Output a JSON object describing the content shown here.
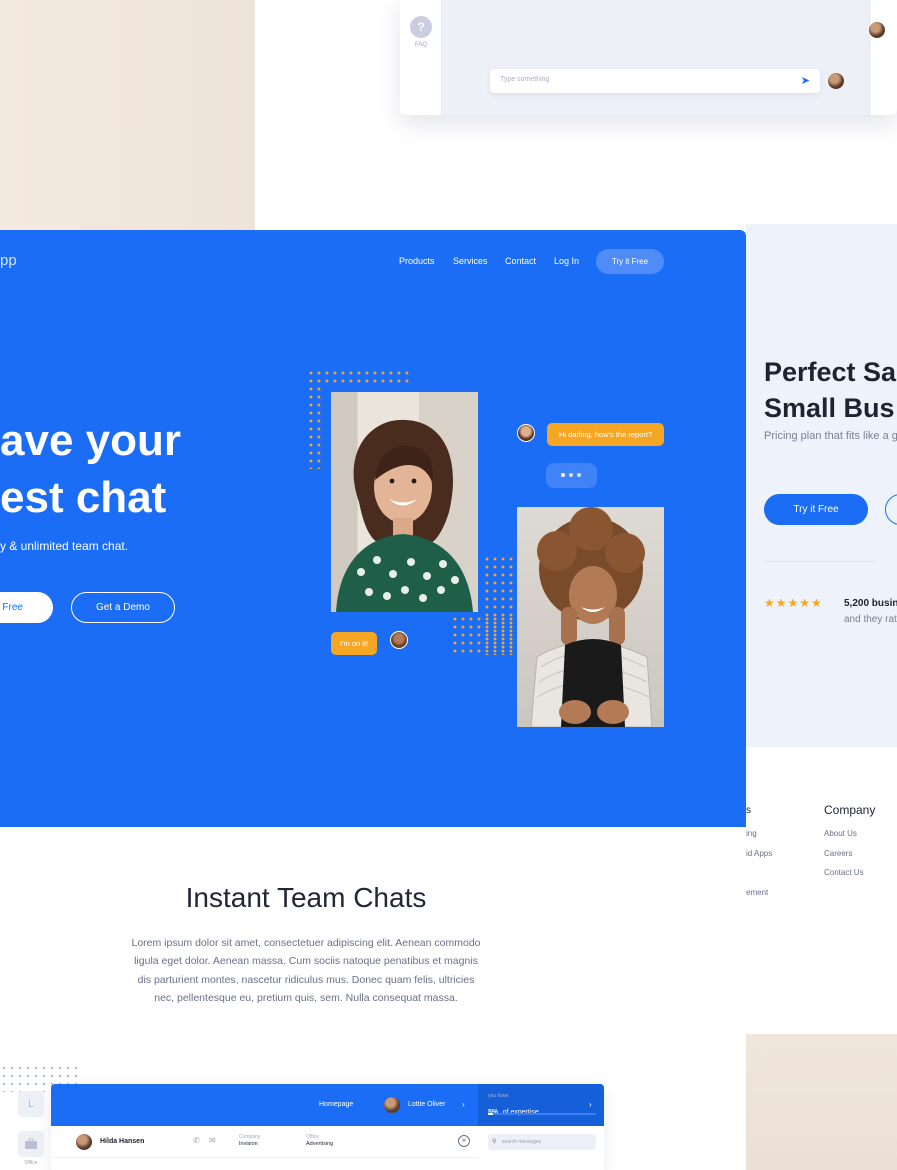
{
  "top_app": {
    "faq_label": "FAQ",
    "faq_icon": "?",
    "message_placeholder": "Type something",
    "send_icon": "➤"
  },
  "hero": {
    "logo_fragment": "pp",
    "nav": [
      "Products",
      "Services",
      "Contact",
      "Log In"
    ],
    "try_free_label": "Try it Free",
    "headline_line1": "ave your",
    "headline_line2": "est chat",
    "subheadline": "y & unlimited team chat.",
    "start_button_label": "t Free",
    "demo_button_label": "Get a Demo",
    "chat_bubble_top": "Hi darling, how's the report?",
    "chat_bubble_bottom": "I'm on it!"
  },
  "pricing": {
    "title_line1": "Perfect Sa",
    "title_line2": "Small Bus",
    "subtitle": "Pricing plan that fits like a g",
    "try_free_label": "Try it Free",
    "stars": "★★★★★",
    "rating": 5,
    "stat_bold": "5,200 busin",
    "stat_sub": "and they rat"
  },
  "footer": {
    "col_a_heading": "s",
    "col_a_items": [
      "ing",
      "id Apps",
      "ement"
    ],
    "company_heading": "Company",
    "company_links": [
      "About Us",
      "Careers",
      "Contact Us"
    ]
  },
  "instant": {
    "title": "Instant Team Chats",
    "paragraph": "Lorem ipsum dolor sit amet, consectetuer adipiscing elit. Aenean commodo ligula eget dolor. Aenean massa. Cum sociis natoque penatibus et magnis dis parturient montes, nascetur ridiculus mus. Donec quam felis, ultricies nec, pellentesque eu, pretium quis, sem. Nulla consequat massa."
  },
  "preview": {
    "side_letter": "L",
    "side_label": "Office",
    "homepage_label": "Homepage",
    "user_name": "Lottie Oliver",
    "expertise_caption": "you have",
    "expertise_value": "5%",
    "expertise_text": "of expertise",
    "expertise_fraction": 0.05,
    "contact_name": "Hilda Hansen",
    "company_label": "Company",
    "company_value": "Invision",
    "office_label": "Office",
    "office_value": "Advertising",
    "search_placeholder": "search messages"
  },
  "colors": {
    "brand_blue": "#1b6df5",
    "accent_orange": "#f5a623"
  }
}
